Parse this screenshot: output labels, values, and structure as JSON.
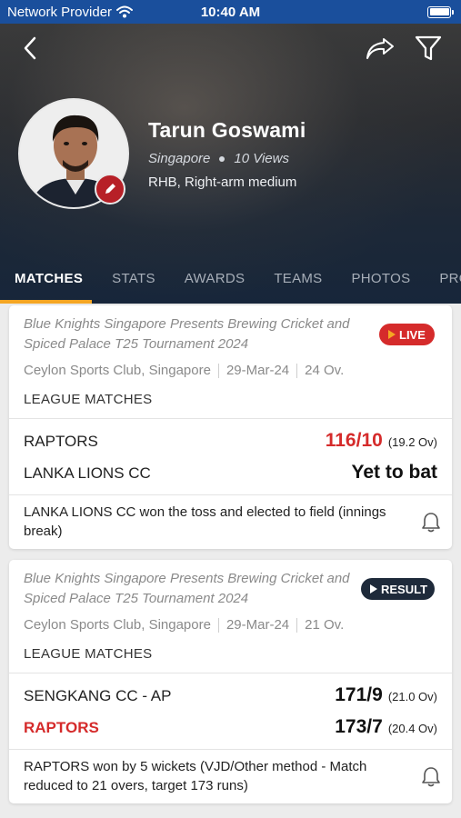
{
  "status_bar": {
    "carrier": "Network Provider",
    "time": "10:40 AM",
    "battery_level": 1.0
  },
  "header": {
    "back_icon": "chevron-left-icon",
    "share_icon": "share-icon",
    "filter_icon": "filter-icon"
  },
  "player": {
    "name": "Tarun Goswami",
    "country": "Singapore",
    "views": "10 Views",
    "style": "RHB, Right-arm medium"
  },
  "tabs": [
    {
      "label": "MATCHES",
      "active": true
    },
    {
      "label": "STATS",
      "active": false
    },
    {
      "label": "AWARDS",
      "active": false
    },
    {
      "label": "TEAMS",
      "active": false
    },
    {
      "label": "PHOTOS",
      "active": false
    },
    {
      "label": "PROFIL",
      "active": false
    }
  ],
  "matches": [
    {
      "tournament": "Blue Knights Singapore Presents  Brewing Cricket and Spiced Palace T25 Tournament 2024",
      "status": "LIVE",
      "venue": "Ceylon Sports Club, Singapore",
      "date": "29-Mar-24",
      "overs": "24 Ov.",
      "match_type": "LEAGUE MATCHES",
      "team1": {
        "name": "RAPTORS",
        "score": "116/10",
        "overs": "(19.2 Ov)"
      },
      "team2": {
        "name": "LANKA LIONS CC",
        "score": "Yet to bat"
      },
      "summary": "LANKA LIONS CC won the toss and elected to field (innings break)"
    },
    {
      "tournament": "Blue Knights Singapore Presents  Brewing Cricket and Spiced Palace T25 Tournament 2024",
      "status": "RESULT",
      "venue": "Ceylon Sports Club, Singapore",
      "date": "29-Mar-24",
      "overs": "21 Ov.",
      "match_type": "LEAGUE MATCHES",
      "team1": {
        "name": "SENGKANG CC - AP",
        "score": "171/9",
        "overs": "(21.0 Ov)"
      },
      "team2": {
        "name": "RAPTORS",
        "score": "173/7",
        "overs": "(20.4 Ov)"
      },
      "summary": "RAPTORS won by 5 wickets (VJD/Other method - Match reduced to 21 overs, target 173 runs)"
    }
  ],
  "colors": {
    "accent": "#f5a623",
    "live": "#d52b2b",
    "result": "#1e2a3a",
    "status_bar": "#1a4f9c"
  }
}
